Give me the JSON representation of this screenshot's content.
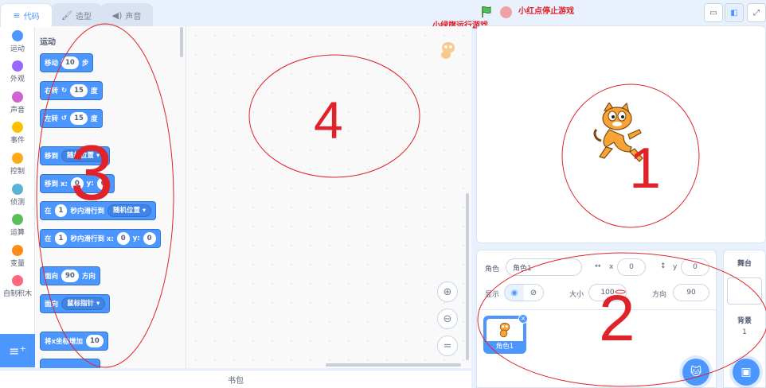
{
  "tabs": [
    {
      "label": "代码",
      "icon": "code-icon",
      "active": true
    },
    {
      "label": "造型",
      "icon": "brush-icon",
      "active": false
    },
    {
      "label": "声音",
      "icon": "speaker-icon",
      "active": false
    }
  ],
  "annotations": {
    "green_flag": "小绿旗运行游戏",
    "red_stop": "小红点停止游戏",
    "n1": "1",
    "n2": "2",
    "n3": "3",
    "n4": "4"
  },
  "categories": [
    {
      "label": "运动",
      "color": "#4c97ff"
    },
    {
      "label": "外观",
      "color": "#9966ff"
    },
    {
      "label": "声音",
      "color": "#cf63cf"
    },
    {
      "label": "事件",
      "color": "#ffbf00"
    },
    {
      "label": "控制",
      "color": "#ffab19"
    },
    {
      "label": "侦测",
      "color": "#5cb1d6"
    },
    {
      "label": "运算",
      "color": "#59c059"
    },
    {
      "label": "变量",
      "color": "#ff8c1a"
    },
    {
      "label": "自制积木",
      "color": "#ff6680"
    }
  ],
  "palette": {
    "title": "运动",
    "blocks": {
      "move": {
        "a": "移动",
        "v": "10",
        "b": "步"
      },
      "turn_right": {
        "a": "右转",
        "v": "15",
        "b": "度"
      },
      "turn_left": {
        "a": "左转",
        "v": "15",
        "b": "度"
      },
      "goto": {
        "a": "移到",
        "dd": "随机位置"
      },
      "goto_xy": {
        "a": "移到 x:",
        "x": "0",
        "y_label": "y:",
        "y": "0"
      },
      "glide": {
        "a": "在",
        "v": "1",
        "b": "秒内滑行到",
        "dd": "随机位置"
      },
      "glide_xy": {
        "a": "在",
        "v": "1",
        "b": "秒内滑行到 x:",
        "x": "0",
        "y_label": "y:",
        "y": "0"
      },
      "point": {
        "a": "面向",
        "v": "90",
        "b": "方向"
      },
      "point_towards": {
        "a": "面向",
        "dd": "鼠标指针"
      },
      "change_x": {
        "a": "将x坐标增加",
        "v": "10"
      }
    }
  },
  "backpack": "书包",
  "sprite_info": {
    "sprite_label": "角色",
    "sprite_name": "角色1",
    "x_label": "x",
    "x": "0",
    "y_label": "y",
    "y": "0",
    "show_label": "显示",
    "size_label": "大小",
    "size": "100",
    "direction_label": "方向",
    "direction": "90"
  },
  "sprites": [
    {
      "name": "角色1"
    }
  ],
  "backdrop": {
    "title": "舞台",
    "label": "背景",
    "count": "1"
  }
}
